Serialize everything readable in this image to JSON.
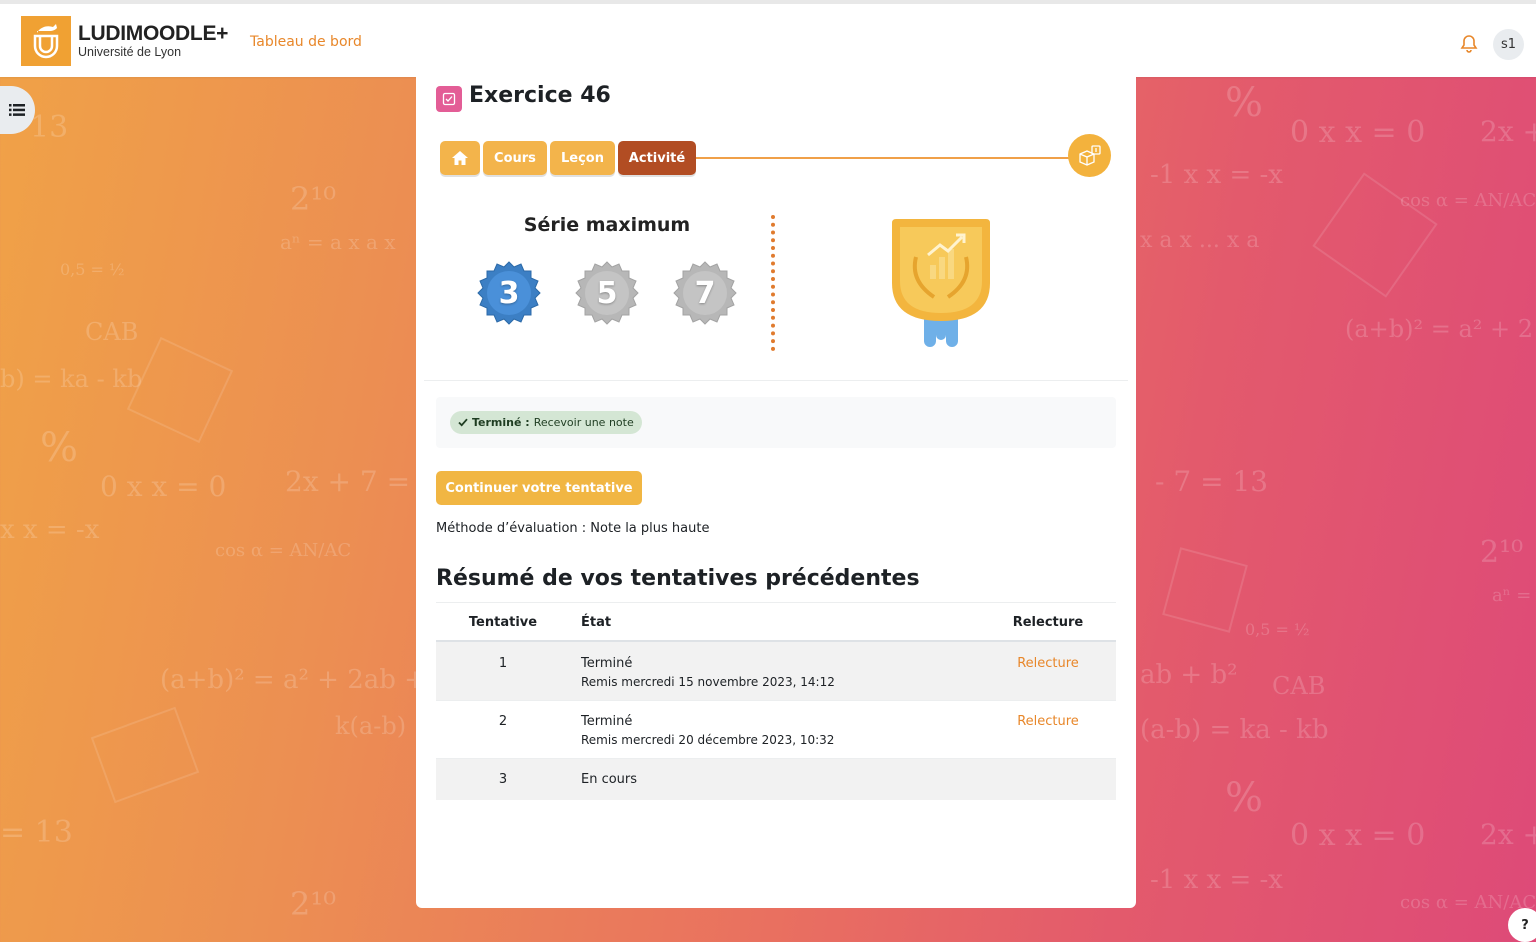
{
  "brand": {
    "name": "LUDIMOODLE+",
    "subtitle": "Université de Lyon",
    "logo_color": "#f0a133"
  },
  "topnav": {
    "dashboard_label": "Tableau de bord",
    "user_initials": "s1",
    "bell_icon": "bell-icon"
  },
  "activity": {
    "icon": "quiz-icon",
    "title": "Exercice 46"
  },
  "breadcrumb": {
    "items": [
      {
        "label": "",
        "icon": "home-icon"
      },
      {
        "label": "Cours"
      },
      {
        "label": "Leçon"
      },
      {
        "label": "Activité"
      }
    ],
    "end_icon": "cube-icon"
  },
  "streak": {
    "title": "Série maximum",
    "badges": [
      {
        "value": "3",
        "state": "active",
        "color": "#3c7fc4"
      },
      {
        "value": "5",
        "state": "inactive",
        "color": "#b7b7b7"
      },
      {
        "value": "7",
        "state": "inactive",
        "color": "#b7b7b7"
      }
    ]
  },
  "completion": {
    "status": "Terminé :",
    "text": "Recevoir une note"
  },
  "actions": {
    "continue_label": "Continuer votre tentative"
  },
  "grading": {
    "text": "Méthode d’évaluation : Note la plus haute"
  },
  "summary": {
    "title": "Résumé de vos tentatives précédentes",
    "columns": [
      "Tentative",
      "État",
      "Relecture"
    ],
    "rows": [
      {
        "attempt": "1",
        "state": "Terminé",
        "submitted": "Remis mercredi 15 novembre 2023, 14:12",
        "review": "Relecture"
      },
      {
        "attempt": "2",
        "state": "Terminé",
        "submitted": "Remis mercredi 20 décembre 2023, 10:32",
        "review": "Relecture"
      },
      {
        "attempt": "3",
        "state": "En cours",
        "submitted": "",
        "review": ""
      }
    ]
  },
  "help": {
    "label": "?"
  }
}
